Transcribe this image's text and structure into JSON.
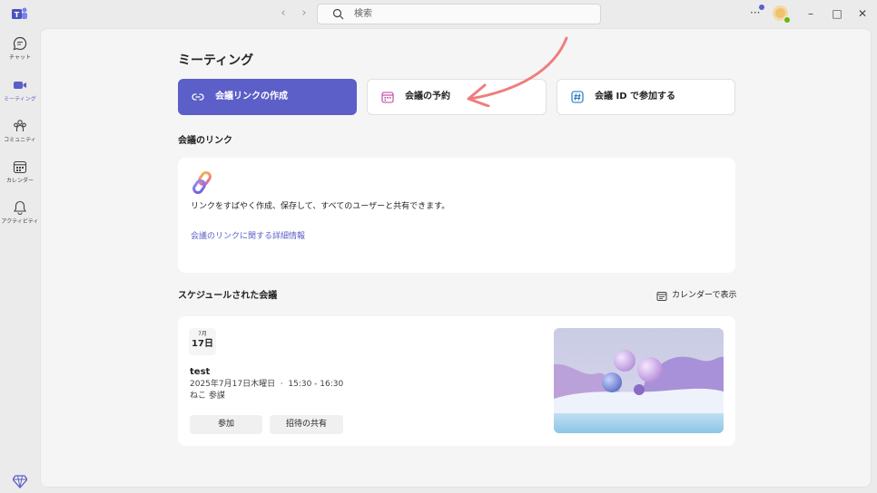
{
  "titlebar": {
    "search_placeholder": "検索",
    "more": "···"
  },
  "rail": {
    "items": [
      {
        "label": "チャット",
        "icon": "chat-icon",
        "active": false
      },
      {
        "label": "ミーティング",
        "icon": "video-icon",
        "active": true
      },
      {
        "label": "コミュニティ",
        "icon": "community-icon",
        "active": false
      },
      {
        "label": "カレンダー",
        "icon": "calendar-icon",
        "active": false
      },
      {
        "label": "アクティビティ",
        "icon": "bell-icon",
        "active": false
      }
    ]
  },
  "page": {
    "title": "ミーティング"
  },
  "actions": {
    "create_link": "会議リンクの作成",
    "schedule": "会議の予約",
    "join_by_id": "会議 ID で参加する"
  },
  "meeting_links": {
    "section_title": "会議のリンク",
    "description": "リンクをすばやく作成、保存して、すべてのユーザーと共有できます。",
    "more_info": "会議のリンクに関する詳細情報"
  },
  "scheduled": {
    "section_title": "スケジュールされた会議",
    "calendar_view": "カレンダーで表示",
    "meeting": {
      "month": "7月",
      "day": "17日",
      "title": "test",
      "datetime": "2025年7月17日木曜日  ·  15:30 - 16:30",
      "organizer": "ねこ 参謀",
      "join_label": "参加",
      "share_label": "招待の共有"
    }
  },
  "colors": {
    "accent": "#5b5fc7",
    "annotation": "#ef7d7d",
    "status_available": "#6bb700"
  }
}
